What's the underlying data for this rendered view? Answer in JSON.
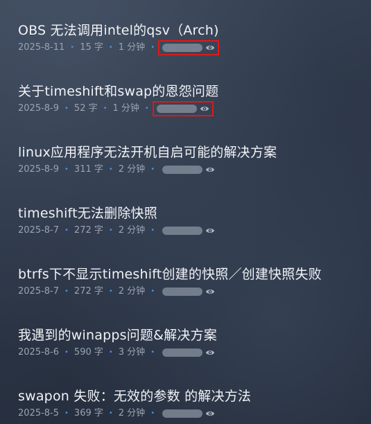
{
  "posts": [
    {
      "title": "OBS 无法调用intel的qsv（Arch)",
      "date": "2025-8-11",
      "words": "15 字",
      "read_time": "1 分钟",
      "views_icon": "eye-icon",
      "highlighted": true
    },
    {
      "title": "关于timeshift和swap的恩怨问题",
      "date": "2025-8-9",
      "words": "52 字",
      "read_time": "1 分钟",
      "views_icon": "eye-icon",
      "highlighted": true
    },
    {
      "title": "linux应用程序无法开机自启可能的解决方案",
      "date": "2025-8-9",
      "words": "311 字",
      "read_time": "2 分钟",
      "views_icon": "eye-icon",
      "highlighted": false
    },
    {
      "title": "timeshift无法删除快照",
      "date": "2025-8-7",
      "words": "272 字",
      "read_time": "2 分钟",
      "views_icon": "eye-icon",
      "highlighted": false
    },
    {
      "title": "btrfs下不显示timeshift创建的快照／创建快照失败",
      "date": "2025-8-7",
      "words": "272 字",
      "read_time": "2 分钟",
      "views_icon": "eye-icon",
      "highlighted": false
    },
    {
      "title": "我遇到的winapps问题&解决方案",
      "date": "2025-8-6",
      "words": "590 字",
      "read_time": "3 分钟",
      "views_icon": "eye-icon",
      "highlighted": false
    },
    {
      "title": "swapon 失败：无效的参数 的解决方法",
      "date": "2025-8-5",
      "words": "369 字",
      "read_time": "2 分钟",
      "views_icon": "eye-icon",
      "highlighted": false
    }
  ],
  "separator": "•",
  "colors": {
    "title": "#f1f3f6",
    "meta": "#9aa4b2",
    "dot": "#4d8fe0",
    "highlight_box": "#e01818"
  }
}
